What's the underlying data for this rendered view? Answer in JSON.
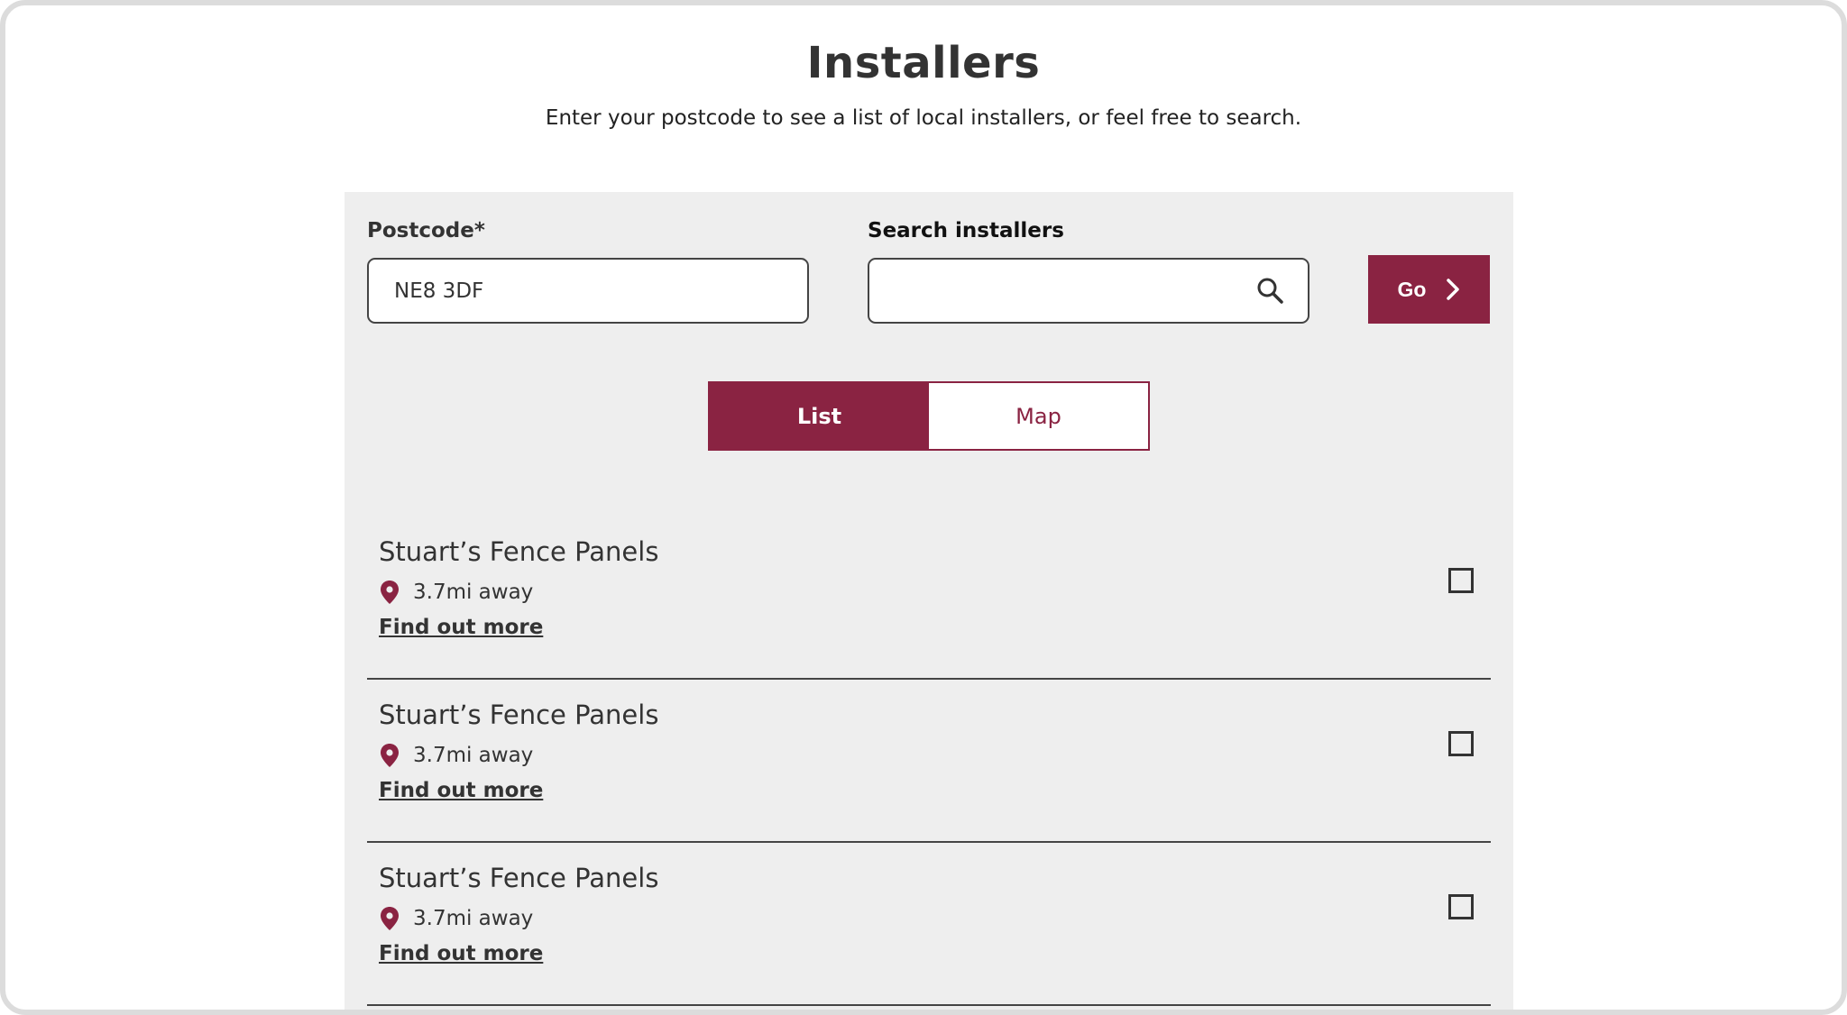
{
  "header": {
    "title": "Installers",
    "subtitle": "Enter your postcode to see a list of local installers, or feel free to search."
  },
  "form": {
    "postcode_label": "Postcode*",
    "postcode_value": "NE8 3DF",
    "search_label": "Search installers",
    "search_value": "",
    "search_icon": "search-icon",
    "go_label": "Go",
    "go_icon": "chevron-right-icon"
  },
  "view_toggle": {
    "list_label": "List",
    "map_label": "Map",
    "selected": "List"
  },
  "results": [
    {
      "name": "Stuart’s Fence Panels",
      "distance": "3.7mi away",
      "link": "Find out more",
      "checked": false
    },
    {
      "name": "Stuart’s Fence Panels",
      "distance": "3.7mi away",
      "link": "Find out more",
      "checked": false
    },
    {
      "name": "Stuart’s Fence Panels",
      "distance": "3.7mi away",
      "link": "Find out more",
      "checked": false
    }
  ],
  "colors": {
    "brand": "#8a2342",
    "panel_background": "#eeeeee",
    "text": "#333333"
  }
}
